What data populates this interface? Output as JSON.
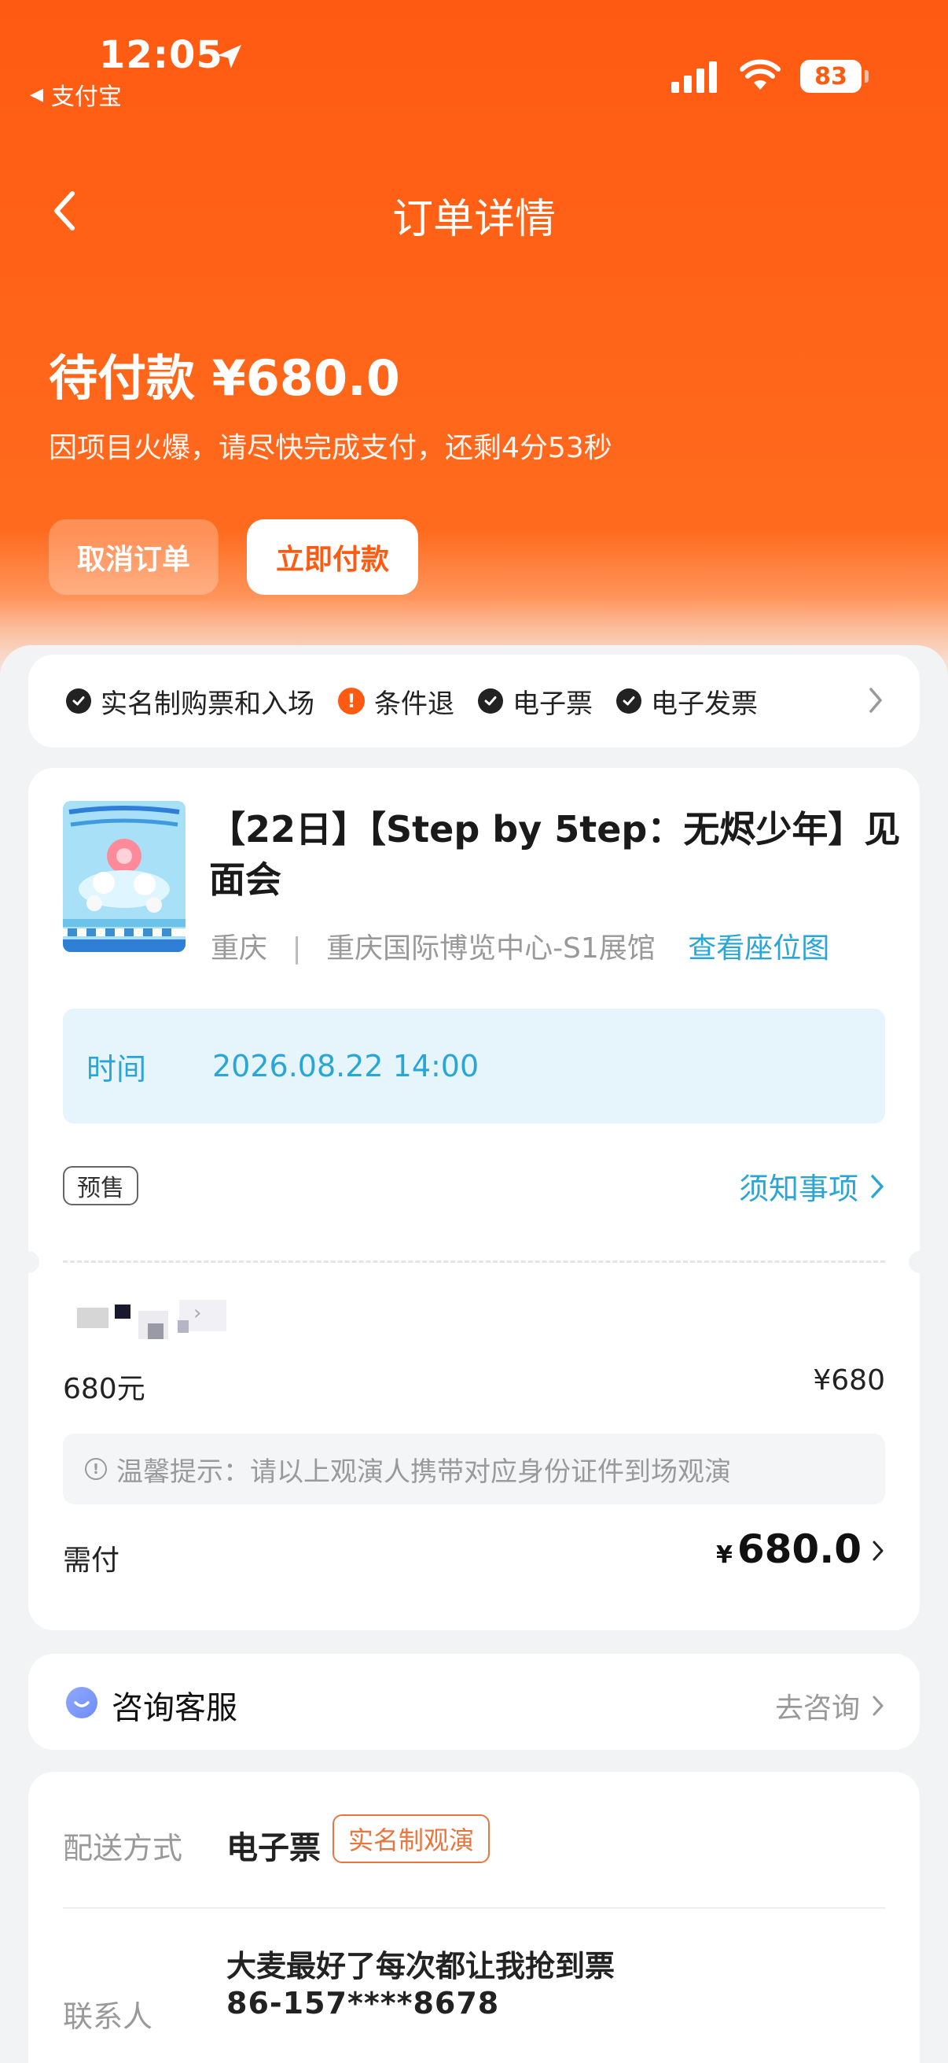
{
  "status_bar": {
    "time": "12:05",
    "back_app": "支付宝",
    "battery": "83",
    "icons": [
      "location-arrow-icon",
      "signal-icon",
      "wifi-icon",
      "battery-icon"
    ]
  },
  "nav": {
    "title": "订单详情",
    "back_icon": "chevron-left-icon"
  },
  "order_status": {
    "title": "待付款 ¥680.0",
    "description": "因项目火爆，请尽快完成支付，还剩4分53秒",
    "cancel_label": "取消订单",
    "pay_label": "立即付款"
  },
  "tags": [
    {
      "label": "实名制购票和入场",
      "icon": "check-circle-icon"
    },
    {
      "label": "条件退",
      "icon": "exclamation-circle-icon"
    },
    {
      "label": "电子票",
      "icon": "check-circle-icon"
    },
    {
      "label": "电子发票",
      "icon": "check-circle-icon"
    }
  ],
  "event": {
    "title": "【22日】【Step by 5tep：无烬少年】见面会",
    "city": "重庆",
    "separator": "|",
    "venue": "重庆国际博览中心-S1展馆",
    "seat_map_link": "查看座位图",
    "time_label": "时间",
    "time_value": "2026.08.22 14:00",
    "presale_badge": "预售",
    "notice_link": "须知事项"
  },
  "ticket": {
    "price_tier": "680元",
    "price": "¥680",
    "tip": "温馨提示：请以上观演人携带对应身份证件到场观演",
    "need_pay_label": "需付",
    "need_pay_currency": "¥",
    "need_pay_amount": "680.0"
  },
  "service": {
    "label": "咨询客服",
    "action": "去咨询"
  },
  "delivery": {
    "label": "配送方式",
    "value": "电子票",
    "badge": "实名制观演",
    "contact_label": "联系人",
    "contact_name": "大麦最好了每次都让我抢到票",
    "contact_phone": "86-157****8678"
  },
  "colors": {
    "brand_orange": "#ff5a12",
    "link_blue": "#2aa6d6",
    "badge_orange": "#e9763f"
  }
}
